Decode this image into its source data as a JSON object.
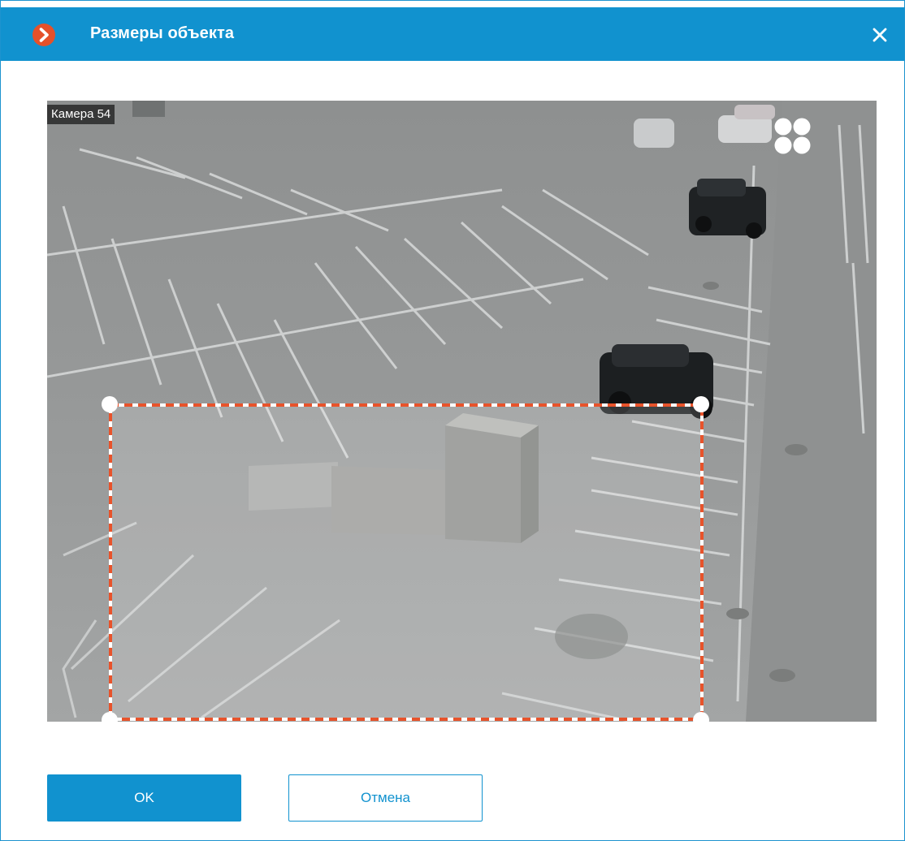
{
  "dialog": {
    "title": "Размеры объекта",
    "logo_icon": "chevron-right-circle-icon",
    "close_icon": "close-icon",
    "accent_color": "#1192cf"
  },
  "video": {
    "camera_label": "Камера 54",
    "layout_icon": "four-dots-grid-icon"
  },
  "selection": {
    "border_color": "#e8532b",
    "handle_color": "#ffffff"
  },
  "buttons": {
    "ok_label": "OK",
    "cancel_label": "Отмена"
  }
}
